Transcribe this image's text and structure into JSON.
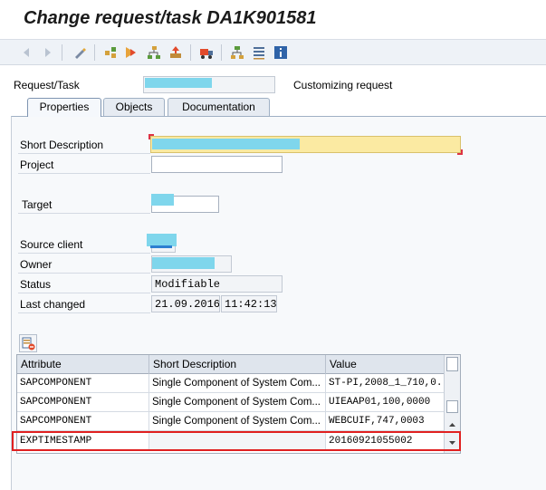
{
  "window": {
    "title": "Change request/task DA1K901581"
  },
  "toolbar": {
    "icons": [
      "back-icon",
      "forward-icon",
      "display-change-icon",
      "hierarchy-icon",
      "execute-icon",
      "tree-icon",
      "transport-icon",
      "truck-icon",
      "org-icon",
      "list-icon",
      "info-icon"
    ]
  },
  "header": {
    "request_label": "Request/Task",
    "request_type": "Customizing request"
  },
  "tabs": [
    {
      "label": "Properties"
    },
    {
      "label": "Objects"
    },
    {
      "label": "Documentation"
    }
  ],
  "properties": {
    "short_description_label": "Short Description",
    "project_label": "Project",
    "target_label": "Target",
    "source_client_label": "Source client",
    "owner_label": "Owner",
    "status_label": "Status",
    "status_value": "Modifiable",
    "last_changed_label": "Last changed",
    "last_changed_date": "21.09.2016",
    "last_changed_time": "11:42:13"
  },
  "grid": {
    "columns": [
      "Attribute",
      "Short Description",
      "Value"
    ],
    "rows": [
      {
        "attribute": "SAPCOMPONENT",
        "description": "Single Component of System Com...",
        "value": "ST-PI,2008_1_710,0..."
      },
      {
        "attribute": "SAPCOMPONENT",
        "description": "Single Component of System Com...",
        "value": "UIEAAP01,100,0000"
      },
      {
        "attribute": "SAPCOMPONENT",
        "description": "Single Component of System Com...",
        "value": "WEBCUIF,747,0003"
      },
      {
        "attribute": "EXPTIMESTAMP",
        "description": "",
        "value": "20160921055002"
      }
    ]
  },
  "colors": {
    "highlight": "#e02020",
    "required_field": "#fbeaa2",
    "redaction": "#7fd6ec"
  }
}
